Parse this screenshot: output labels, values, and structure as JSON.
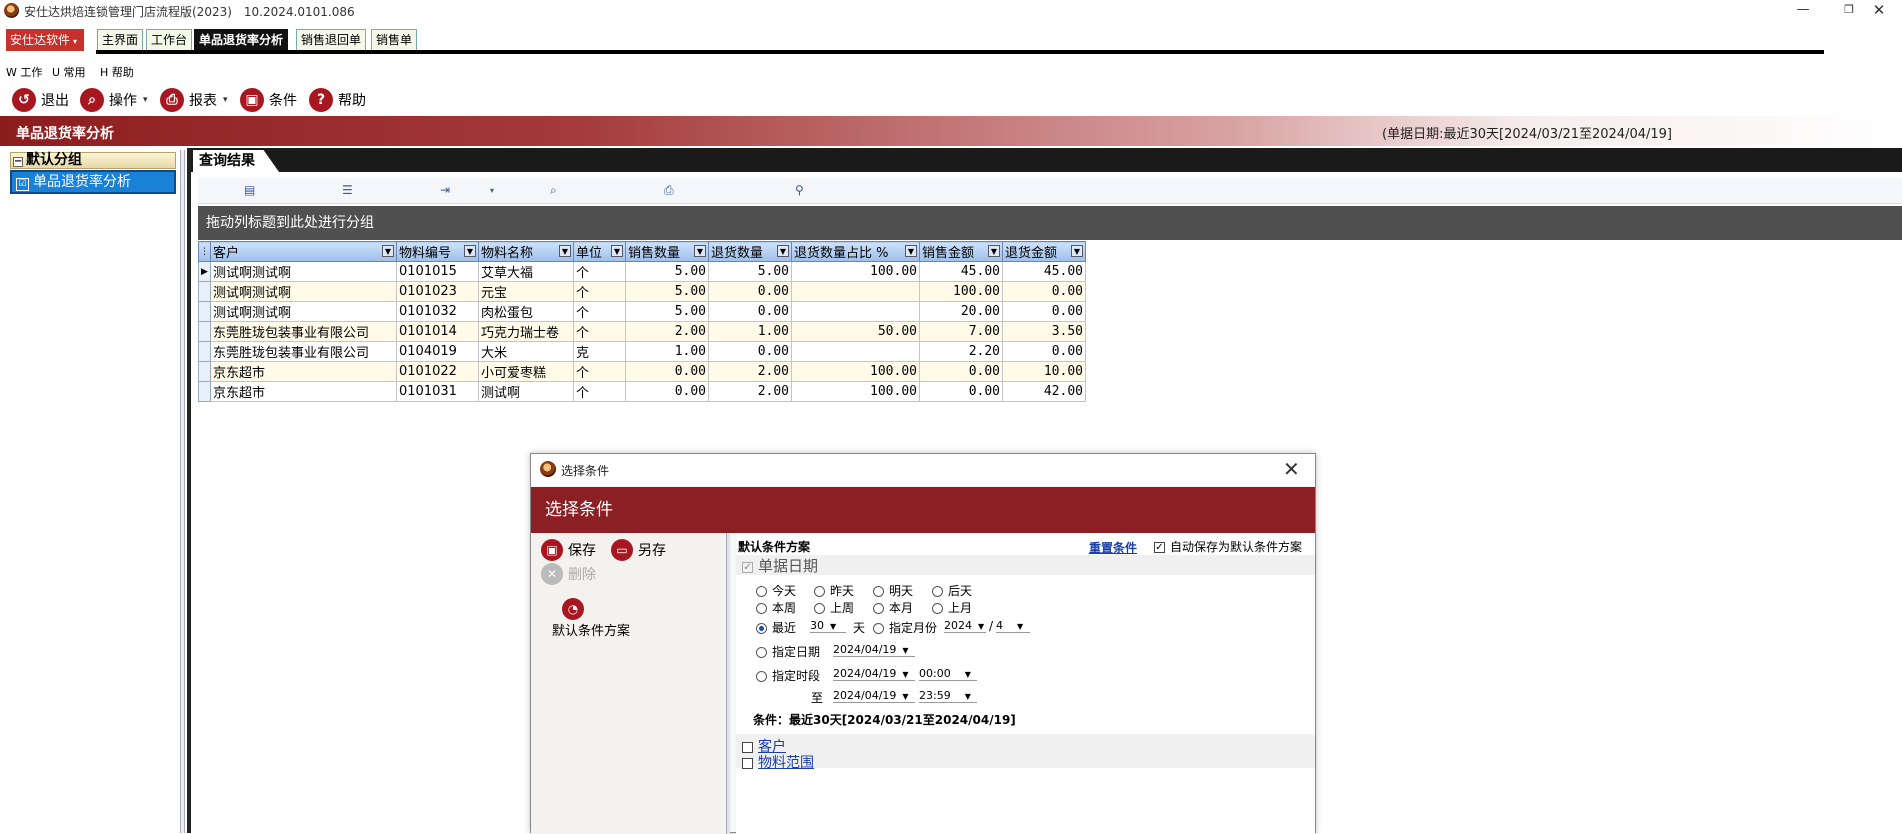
{
  "window": {
    "title": "安仕达烘焙连锁管理门店流程版(2023)　10.2024.0101.086",
    "controls": [
      "—",
      "❐",
      "✕"
    ]
  },
  "tabs": {
    "brand": "安仕达软件",
    "items": [
      "主界面",
      "工作台",
      "单品退货率分析",
      "销售退回单",
      "销售单"
    ],
    "active": "单品退货率分析"
  },
  "menu": {
    "items": [
      "W 工作",
      "U 常用",
      "H 帮助"
    ]
  },
  "toolbar": {
    "exit": "退出",
    "operate": "操作",
    "report": "报表",
    "condition": "条件",
    "help": "帮助"
  },
  "header": {
    "title": "单品退货率分析",
    "date_range": "(单据日期:最近30天[2024/03/21至2024/04/19]"
  },
  "left": {
    "group_title": "默认分组",
    "item": "单品退货率分析"
  },
  "results": {
    "tab": "查询结果",
    "group_hint": "拖动列标题到此处进行分组",
    "columns": [
      "客户",
      "物料编号",
      "物料名称",
      "单位",
      "销售数量",
      "退货数量",
      "退货数量占比 %",
      "销售金额",
      "退货金额"
    ],
    "rows": [
      [
        "测试啊测试啊",
        "0101015",
        "艾草大福",
        "个",
        "5.00",
        "5.00",
        "100.00",
        "45.00",
        "45.00"
      ],
      [
        "测试啊测试啊",
        "0101023",
        "元宝",
        "个",
        "5.00",
        "0.00",
        "",
        "100.00",
        "0.00"
      ],
      [
        "测试啊测试啊",
        "0101032",
        "肉松蛋包",
        "个",
        "5.00",
        "0.00",
        "",
        "20.00",
        "0.00"
      ],
      [
        "东莞胜珑包装事业有限公司",
        "0101014",
        "巧克力瑞士卷",
        "个",
        "2.00",
        "1.00",
        "50.00",
        "7.00",
        "3.50"
      ],
      [
        "东莞胜珑包装事业有限公司",
        "0104019",
        "大米",
        "克",
        "1.00",
        "0.00",
        "",
        "2.20",
        "0.00"
      ],
      [
        "京东超市",
        "0101022",
        "小可爱枣糕",
        "个",
        "0.00",
        "2.00",
        "100.00",
        "0.00",
        "10.00"
      ],
      [
        "京东超市",
        "0101031",
        "测试啊",
        "个",
        "0.00",
        "2.00",
        "100.00",
        "0.00",
        "42.00"
      ]
    ]
  },
  "dialog": {
    "window_title": "选择条件",
    "header": "选择条件",
    "save": "保存",
    "save_as": "另存",
    "delete": "删除",
    "scheme_name": "默认条件方案",
    "section_title": "默认条件方案",
    "reset": "重置条件",
    "auto_save": "自动保存为默认条件方案",
    "date_group": "单据日期",
    "radios": {
      "today": "今天",
      "yesterday": "昨天",
      "tomorrow": "明天",
      "day_after": "后天",
      "this_week": "本周",
      "last_week": "上周",
      "this_month": "本月",
      "last_month": "上月",
      "recent": "最近",
      "days_unit": "天",
      "specified_month": "指定月份",
      "specified_date": "指定日期",
      "specified_period": "指定时段",
      "to": "至"
    },
    "recent_days": "30",
    "month_year": "2024",
    "month_sep": "/",
    "month_value": "4",
    "date_value": "2024/04/19",
    "period_from_date": "2024/04/19",
    "period_from_time": "00:00",
    "period_to_date": "2024/04/19",
    "period_to_time": "23:59",
    "summary": "条件：最近30天[2024/03/21至2024/04/19]",
    "extra": [
      "客户",
      "物料范围"
    ]
  }
}
